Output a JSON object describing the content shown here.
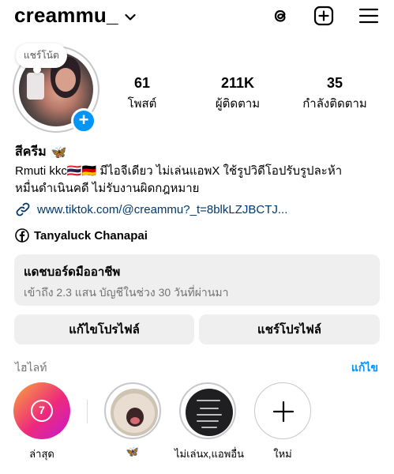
{
  "header": {
    "username": "creammu_",
    "icons": [
      "chevron-down-icon",
      "threads-icon",
      "new-post-icon",
      "menu-icon"
    ]
  },
  "profile": {
    "note": "แชร์โน้ต",
    "stats": [
      {
        "value": "61",
        "label": "โพสต์"
      },
      {
        "value": "211K",
        "label": "ผู้ติดตาม"
      },
      {
        "value": "35",
        "label": "กำลังติดตาม"
      }
    ],
    "name": "สีครีม",
    "name_emoji": "🦋",
    "bio_line1": "Rmuti kkc🇹🇭🇩🇪 มีไอจีเดียว ไม่เล่นแอพX ใช้รูปวิดีโอปรับรูปละห้า",
    "bio_line2": "หมื่นดำเนินคดี ไม่รับงานผิดกฎหมาย",
    "link": "www.tiktok.com/@creammu?_t=8blkLZJBCTJ...",
    "facebook": "Tanyaluck Chanapai"
  },
  "dashboard": {
    "title": "แดชบอร์ดมืออาชีพ",
    "subtitle": "เข้าถึง 2.3 แสน บัญชีในช่วง 30 วันที่ผ่านมา"
  },
  "buttons": {
    "edit": "แก้ไขโปรไฟล์",
    "share": "แชร์โปรไฟล์"
  },
  "highlights": {
    "header": "ไฮไลท์",
    "edit": "แก้ไข",
    "items": [
      {
        "label": "ล่าสุด",
        "badge": "7"
      },
      {
        "label": "🦋"
      },
      {
        "label": "ไม่เล่นx,แอพอื่น"
      },
      {
        "label": "ใหม่"
      }
    ]
  },
  "colors": {
    "accent": "#0095f6",
    "link": "#00376b",
    "button_bg": "#efeff0"
  }
}
